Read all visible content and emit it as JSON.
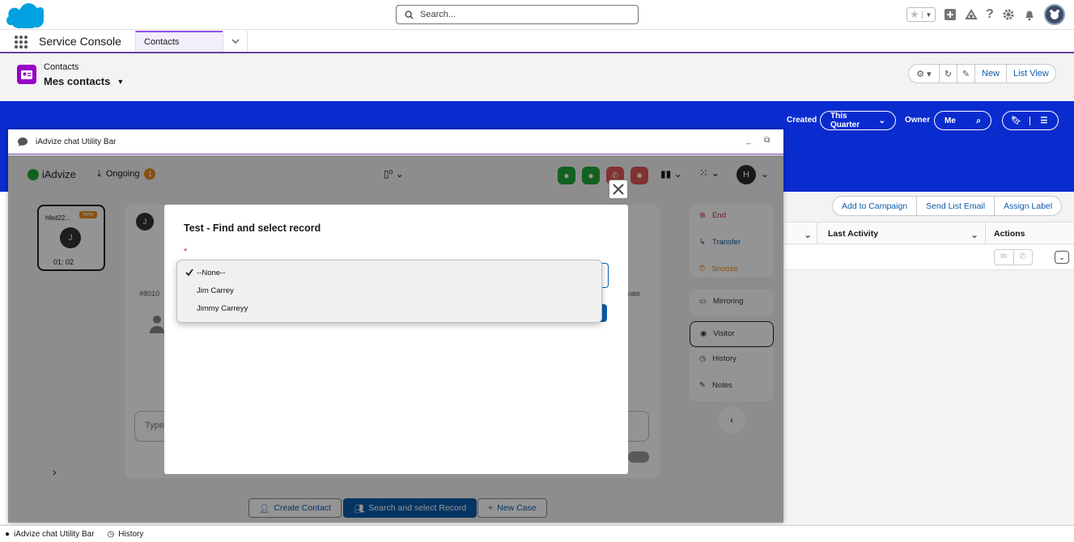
{
  "global": {
    "search_placeholder": "Search...",
    "app_name": "Service Console",
    "tab_label": "Contacts"
  },
  "header": {
    "object_label": "Contacts",
    "list_name": "Mes contacts",
    "buttons": {
      "new": "New",
      "list_view": "List View"
    }
  },
  "filters": {
    "created_label": "Created",
    "created_value": "This Quarter",
    "owner_label": "Owner",
    "owner_value": "Me"
  },
  "list_actions": [
    "Add to Campaign",
    "Send List Email",
    "Assign Label"
  ],
  "columns": {
    "last_activity": "Last Activity",
    "actions": "Actions"
  },
  "utility_panel": {
    "title": "iAdvize chat Utility Bar",
    "brand": "iAdvize",
    "ongoing_label": "Ongoing",
    "ongoing_count": "1",
    "user_initial": "H",
    "conversation": {
      "visitor_id": "hfed22...",
      "badge": "New",
      "avatar_initial": "J",
      "timer": "01: 02"
    },
    "chat_avatar_initial": "J",
    "ref_number": "#8010",
    "private_suffix": "vate",
    "input_placeholder": "Type",
    "side_actions": {
      "end": "End",
      "transfer": "Transfer",
      "snooze": "Snooze"
    },
    "side_menu": [
      "Mirroring",
      "Visitor",
      "History",
      "Notes"
    ],
    "bottom_buttons": {
      "create_contact": "Create Contact",
      "search_select": "Search and select Record",
      "new_case": "New Case"
    }
  },
  "modal": {
    "title": "Test - Find and select record",
    "required_mark": "*",
    "options": [
      "--None--",
      "Jim Carrey",
      "Jimmy Carreyy"
    ],
    "selected": "--None--"
  },
  "utility_bar": {
    "items": [
      "iAdvize chat Utility Bar",
      "History"
    ]
  },
  "colors": {
    "brand_blue": "#0a2ccf",
    "accent_purple": "#6b3fa0",
    "link": "#0b5cab",
    "iadvize_green": "#1fa83a"
  }
}
